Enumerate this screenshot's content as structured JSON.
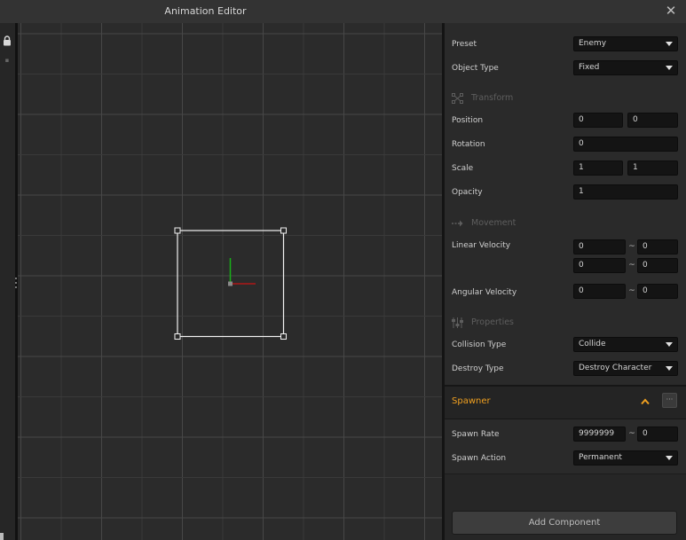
{
  "window": {
    "title": "Animation Editor",
    "close_glyph": "✕"
  },
  "left_strip": {
    "icon": "lock-icon"
  },
  "properties": {
    "preset": {
      "label": "Preset",
      "value": "Enemy"
    },
    "object_type": {
      "label": "Object Type",
      "value": "Fixed"
    },
    "transform": {
      "header": "Transform",
      "icon": "transform-icon",
      "position": {
        "label": "Position",
        "x": "0",
        "y": "0"
      },
      "rotation": {
        "label": "Rotation",
        "value": "0"
      },
      "scale": {
        "label": "Scale",
        "x": "1",
        "y": "1"
      },
      "opacity": {
        "label": "Opacity",
        "value": "1"
      }
    },
    "movement": {
      "header": "Movement",
      "icon": "arrow-right-icon",
      "linear_velocity": {
        "label": "Linear Velocity",
        "x_min": "0",
        "x_max": "0",
        "y_min": "0",
        "y_max": "0"
      },
      "angular_velocity": {
        "label": "Angular Velocity",
        "min": "0",
        "max": "0"
      }
    },
    "props": {
      "header": "Properties",
      "icon": "sliders-icon",
      "collision_type": {
        "label": "Collision Type",
        "value": "Collide"
      },
      "destroy_type": {
        "label": "Destroy Type",
        "value": "Destroy Character"
      }
    },
    "range_separator": "~"
  },
  "spawner": {
    "title": "Spawner",
    "more_label": "···",
    "spawn_rate": {
      "label": "Spawn Rate",
      "min": "9999999",
      "max": "0"
    },
    "spawn_action": {
      "label": "Spawn Action",
      "value": "Permanent"
    }
  },
  "footer": {
    "add_component_label": "Add Component"
  },
  "colors": {
    "accent": "#f0a020",
    "viewport_bg": "#2b2b2b",
    "panel_bg": "#2a2a2a",
    "input_bg": "#141414",
    "axis_x": "#b01818",
    "axis_y": "#18b018"
  }
}
